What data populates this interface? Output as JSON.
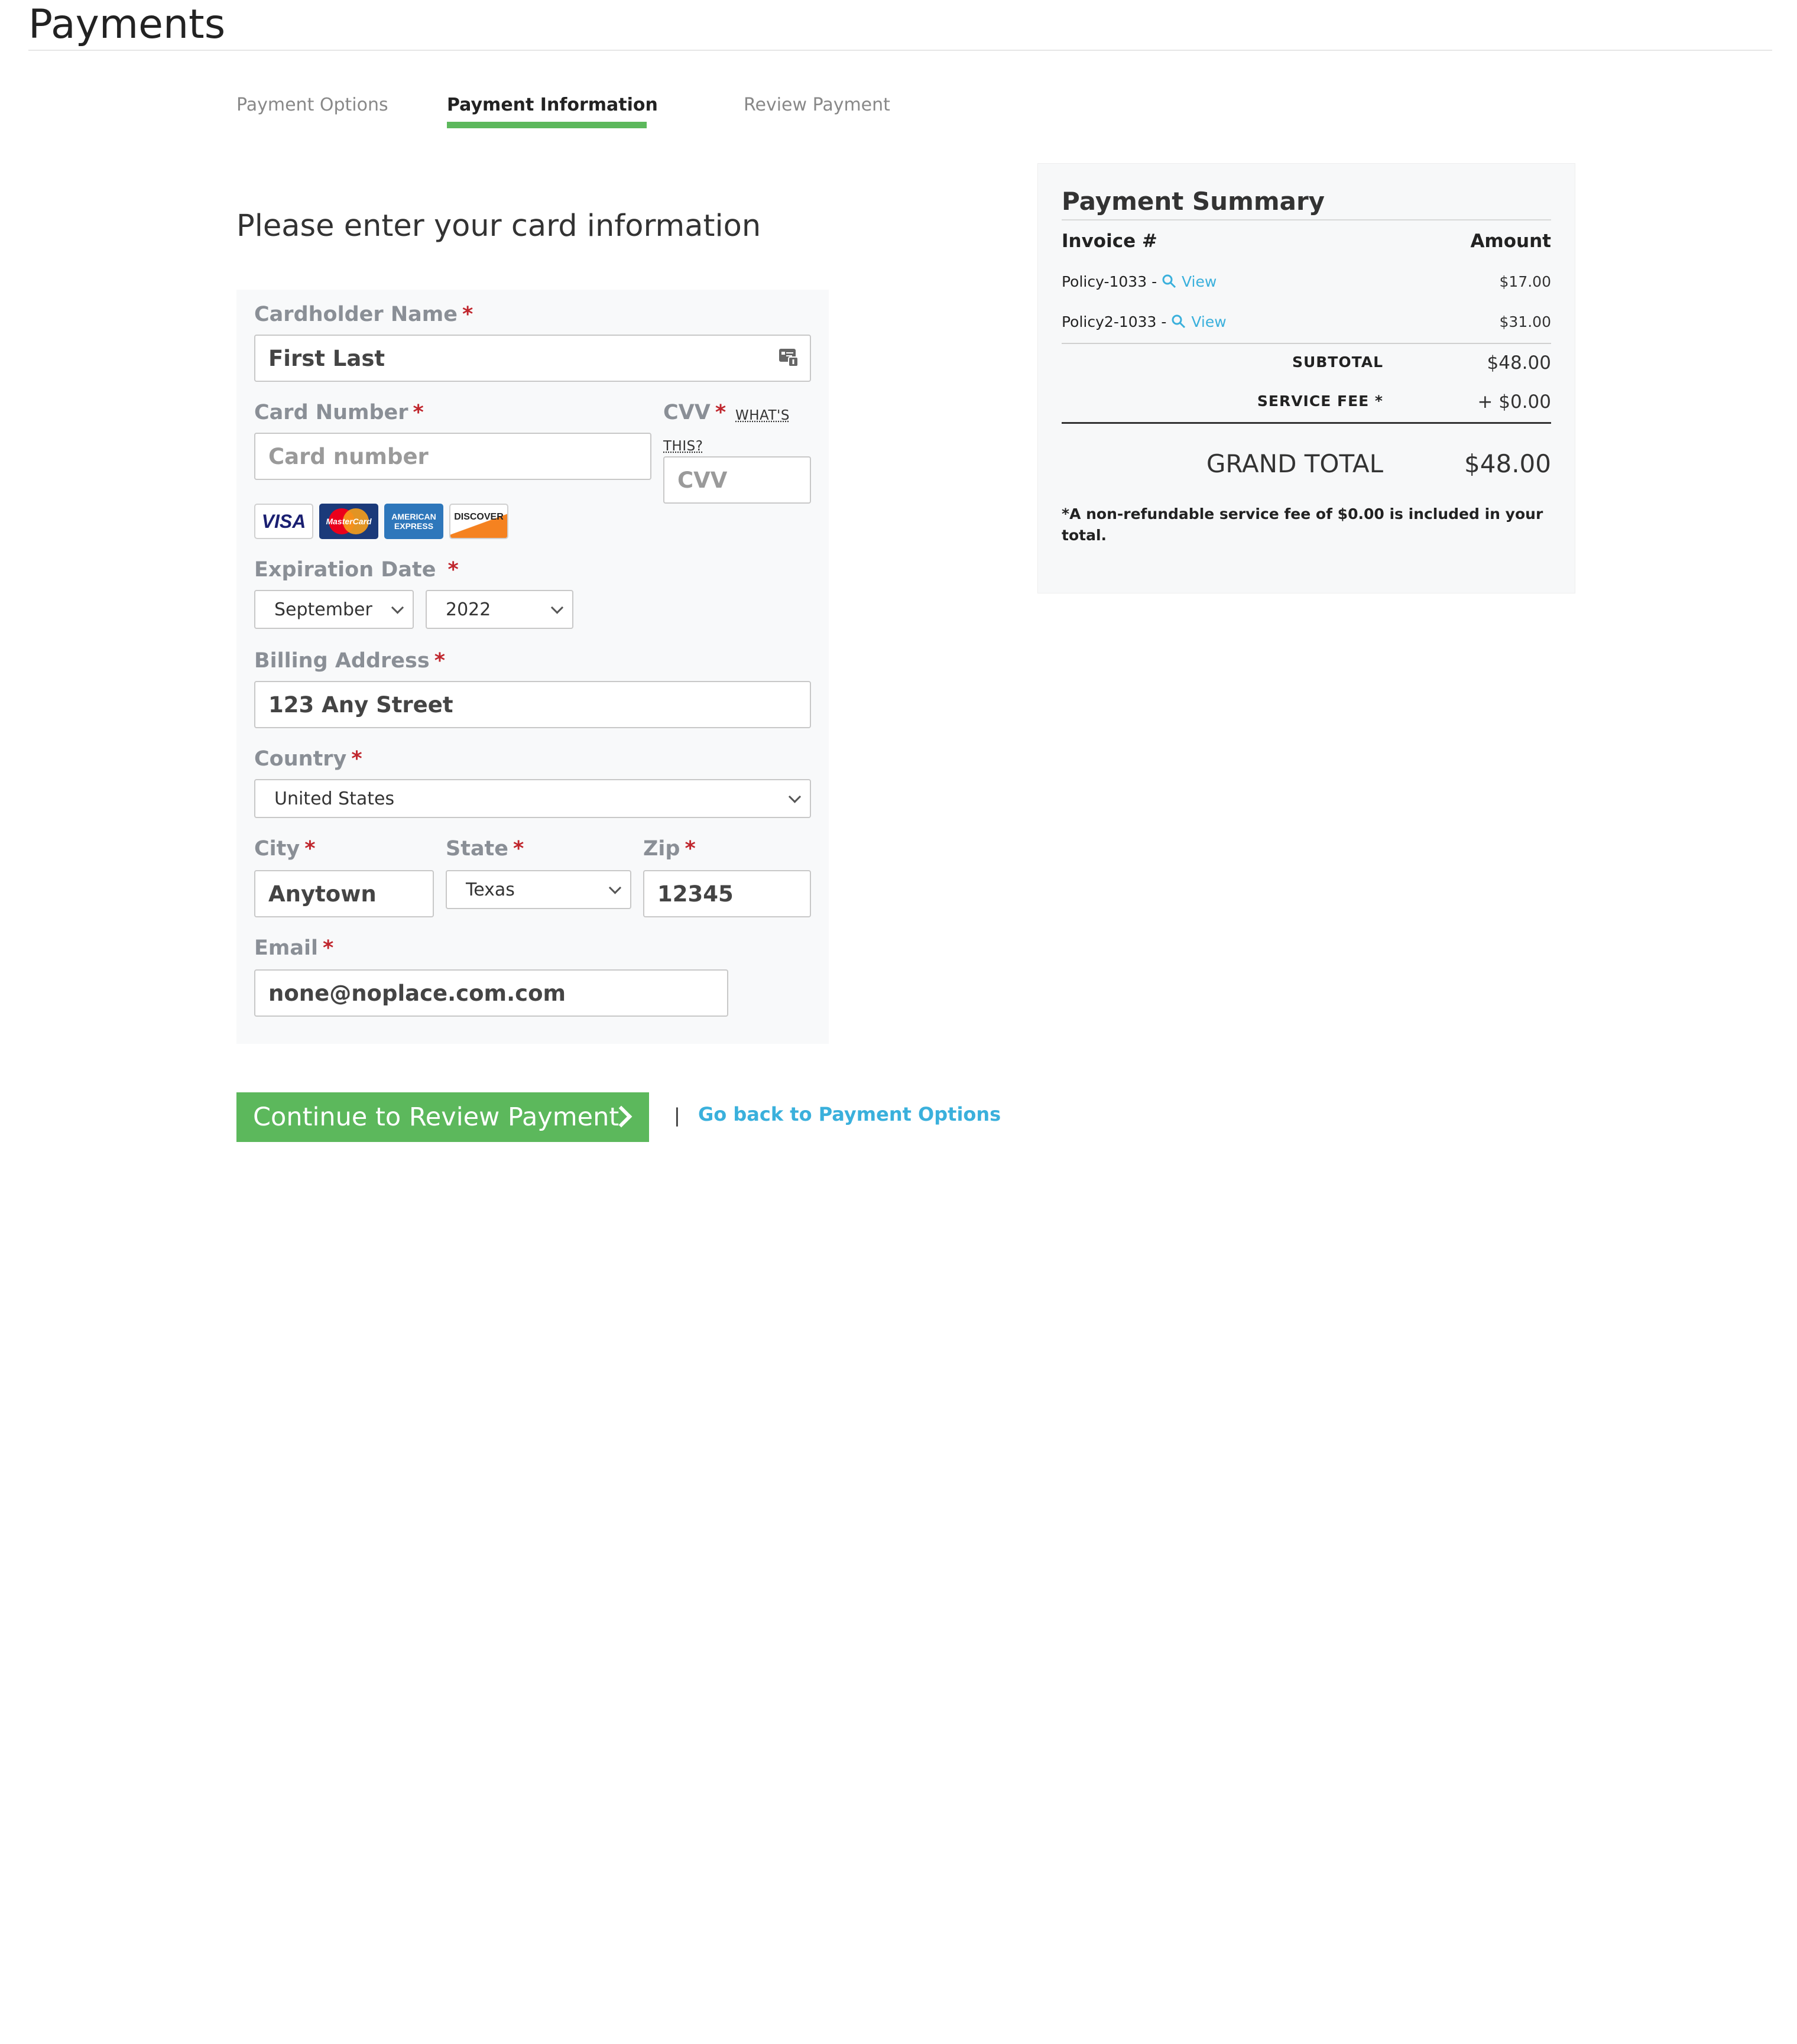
{
  "page": {
    "title": "Payments"
  },
  "steps": [
    {
      "label": "Payment Options",
      "active": false
    },
    {
      "label": "Payment Information",
      "active": true
    },
    {
      "label": "Review Payment",
      "active": false
    }
  ],
  "form": {
    "heading": "Please enter your card information",
    "required_mark": "*",
    "cardholder": {
      "label": "Cardholder Name",
      "value": "First Last"
    },
    "card_number": {
      "label": "Card Number",
      "value": "",
      "placeholder": "Card number"
    },
    "cvv": {
      "label": "CVV",
      "whats_this": "WHAT'S",
      "whats_this_2": "THIS?",
      "value": "",
      "placeholder": "CVV"
    },
    "card_brands": [
      "VISA",
      "MasterCard",
      "AMERICAN EXPRESS",
      "DISCOVER"
    ],
    "expiration": {
      "label": "Expiration Date",
      "month": "September",
      "year": "2022"
    },
    "billing_address": {
      "label": "Billing Address",
      "value": "123 Any Street"
    },
    "country": {
      "label": "Country",
      "value": "United States"
    },
    "city": {
      "label": "City",
      "value": "Anytown"
    },
    "state": {
      "label": "State",
      "value": "Texas"
    },
    "zip": {
      "label": "Zip",
      "value": "12345"
    },
    "email": {
      "label": "Email",
      "value": "none@noplace.com.com"
    }
  },
  "actions": {
    "continue_label": "Continue to Review Payment",
    "separator": "|",
    "back_label": "Go back to Payment Options"
  },
  "summary": {
    "title": "Payment Summary",
    "col_invoice": "Invoice #",
    "col_amount": "Amount",
    "invoices": [
      {
        "id": "Policy-1033 -",
        "link": "View",
        "amount": "$17.00"
      },
      {
        "id": "Policy2-1033 -",
        "link": "View",
        "amount": "$31.00"
      }
    ],
    "subtotal_label": "SUBTOTAL",
    "subtotal_value": "$48.00",
    "fee_label": "SERVICE FEE *",
    "fee_value": "+ $0.00",
    "grand_label": "GRAND TOTAL",
    "grand_value": "$48.00",
    "note": "*A non-refundable service fee of $0.00 is included in your total."
  },
  "colors": {
    "accent": "#5cb85c",
    "link": "#3ab0dc",
    "required": "#c0262d"
  }
}
